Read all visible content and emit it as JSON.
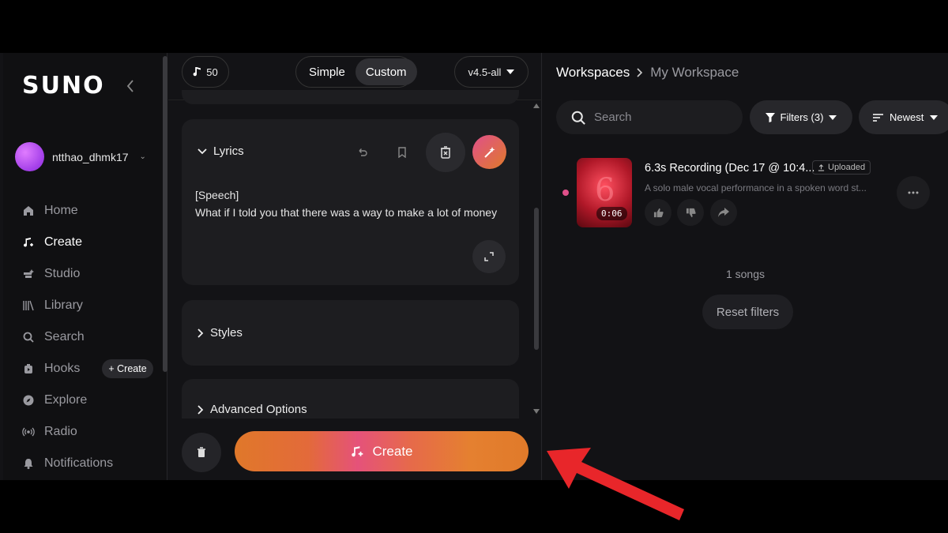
{
  "sidebar": {
    "logo": "SUNO",
    "username": "ntthao_dhmk17",
    "items": [
      {
        "label": "Home",
        "icon": "home-icon",
        "active": false
      },
      {
        "label": "Create",
        "icon": "create-music-icon",
        "active": true
      },
      {
        "label": "Studio",
        "icon": "studio-icon",
        "active": false
      },
      {
        "label": "Library",
        "icon": "library-icon",
        "active": false
      },
      {
        "label": "Search",
        "icon": "search-icon",
        "active": false
      },
      {
        "label": "Hooks",
        "icon": "hooks-icon",
        "active": false
      },
      {
        "label": "Explore",
        "icon": "explore-icon",
        "active": false
      },
      {
        "label": "Radio",
        "icon": "radio-icon",
        "active": false
      },
      {
        "label": "Notifications",
        "icon": "bell-icon",
        "active": false
      }
    ],
    "hooks_create": "+ Create"
  },
  "topbar": {
    "credits": "50",
    "mode_simple": "Simple",
    "mode_custom": "Custom",
    "version": "v4.5-all"
  },
  "lyrics": {
    "header": "Lyrics",
    "line1": "[Speech]",
    "line2": "What if I told you that there was a way to make a lot of money"
  },
  "styles": {
    "header": "Styles"
  },
  "advanced": {
    "header": "Advanced Options"
  },
  "create_button": "Create",
  "workspace": {
    "crumb_root": "Workspaces",
    "crumb_current": "My Workspace",
    "search_placeholder": "Search",
    "filters_label": "Filters (3)",
    "sort_label": "Newest",
    "song": {
      "title": "6.3s Recording (Dec 17 @ 10:4...",
      "badge": "Uploaded",
      "description": "A solo male vocal performance in a spoken word st...",
      "duration": "0:06",
      "thumb_digit": "6"
    },
    "count": "1 songs",
    "reset": "Reset filters"
  },
  "colors": {
    "accent_pink": "#e0508a",
    "create_orange": "#e07a2a",
    "annotation_arrow": "#e8262a"
  }
}
